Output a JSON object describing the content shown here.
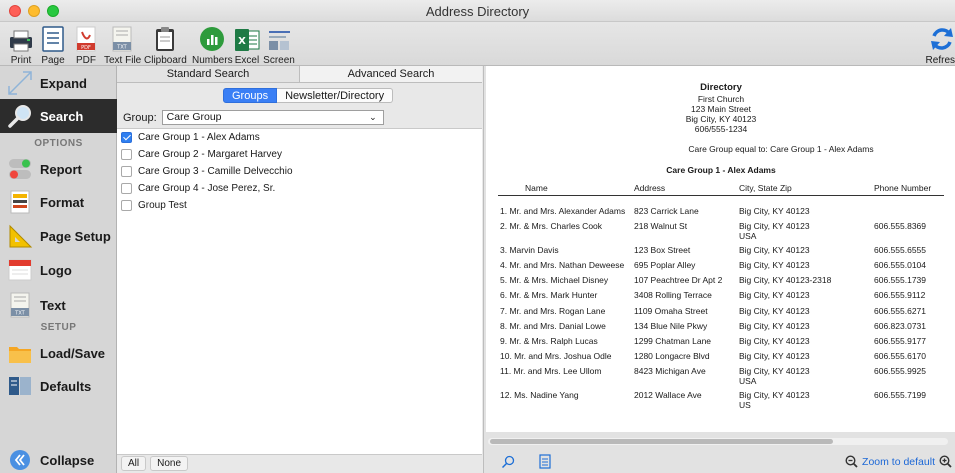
{
  "window": {
    "title": "Address Directory"
  },
  "toolbar": {
    "items": [
      {
        "label": "Print",
        "icon": "printer-icon"
      },
      {
        "label": "Page",
        "icon": "page-icon"
      },
      {
        "label": "PDF",
        "icon": "pdf-icon"
      },
      {
        "label": "Text File",
        "icon": "text-file-icon"
      },
      {
        "label": "Clipboard",
        "icon": "clipboard-icon"
      },
      {
        "label": "Numbers",
        "icon": "numbers-icon"
      },
      {
        "label": "Excel",
        "icon": "excel-icon"
      },
      {
        "label": "Screen",
        "icon": "screen-icon"
      }
    ],
    "refresh_label": "Refres"
  },
  "sidebar": {
    "items": [
      {
        "label": "Expand",
        "icon": "expand-icon"
      },
      {
        "label": "Search",
        "icon": "search-icon",
        "active": true
      },
      {
        "label": "Report",
        "icon": "toggle-icon"
      },
      {
        "label": "Format",
        "icon": "format-icon"
      },
      {
        "label": "Page Setup",
        "icon": "page-setup-icon"
      },
      {
        "label": "Logo",
        "icon": "logo-icon"
      },
      {
        "label": "Text",
        "icon": "text-icon"
      },
      {
        "label": "Load/Save",
        "icon": "folder-icon"
      },
      {
        "label": "Defaults",
        "icon": "defaults-icon"
      },
      {
        "label": "Collapse",
        "icon": "collapse-icon"
      }
    ],
    "section_options": "OPTIONS",
    "section_setup": "SETUP"
  },
  "search": {
    "tabs": [
      "Standard Search",
      "Advanced Search"
    ],
    "subtabs": [
      "Groups",
      "Newsletter/Directory"
    ],
    "group_label": "Group:",
    "group_value": "Care Group",
    "groups": [
      {
        "name": "Care Group 1 - Alex Adams",
        "checked": true
      },
      {
        "name": "Care Group 2 - Margaret Harvey",
        "checked": false
      },
      {
        "name": "Care Group 3 - Camille Delvecchio",
        "checked": false
      },
      {
        "name": "Care Group 4 - Jose Perez, Sr.",
        "checked": false
      },
      {
        "name": "Group Test",
        "checked": false
      }
    ],
    "all_label": "All",
    "none_label": "None"
  },
  "preview": {
    "title": "Directory",
    "org": "First Church",
    "street": "123 Main Street",
    "city": "Big City, KY  40123",
    "phone": "606/555-1234",
    "criteria": "Care Group equal to: Care Group 1 - Alex Adams",
    "group_heading": "Care Group 1 - Alex Adams",
    "columns": [
      "Name",
      "Address",
      "City, State  Zip",
      "Phone Number"
    ],
    "rows": [
      {
        "name": "1. Mr. and Mrs. Alexander Adams",
        "address": "823 Carrick Lane",
        "city": "Big City, KY 40123",
        "city2": "",
        "phone": ""
      },
      {
        "name": "2. Mr. & Mrs. Charles Cook",
        "address": "218 Walnut St",
        "city": "Big City, KY 40123",
        "city2": "USA",
        "phone": "606.555.8369"
      },
      {
        "name": "3. Marvin Davis",
        "address": "123 Box Street",
        "city": "Big City, KY 40123",
        "city2": "",
        "phone": "606.555.6555"
      },
      {
        "name": "4. Mr. and Mrs. Nathan Deweese",
        "address": "695 Poplar Alley",
        "city": "Big City, KY 40123",
        "city2": "",
        "phone": "606.555.0104"
      },
      {
        "name": "5. Mr. & Mrs. Michael Disney",
        "address": "107 Peachtree Dr  Apt 2",
        "city": "Big City, KY 40123-2318",
        "city2": "",
        "phone": "606.555.1739"
      },
      {
        "name": "6. Mr. & Mrs. Mark Hunter",
        "address": "3408 Rolling Terrace",
        "city": "Big City, KY 40123",
        "city2": "",
        "phone": "606.555.9112"
      },
      {
        "name": "7. Mr. and Mrs. Rogan Lane",
        "address": "1109 Omaha Street",
        "city": "Big City, KY 40123",
        "city2": "",
        "phone": "606.555.6271"
      },
      {
        "name": "8. Mr. and Mrs. Danial Lowe",
        "address": "134 Blue Nile Pkwy",
        "city": "Big City, KY 40123",
        "city2": "",
        "phone": "606.823.0731"
      },
      {
        "name": "9. Mr. & Mrs. Ralph Lucas",
        "address": "1299 Chatman Lane",
        "city": "Big City, KY 40123",
        "city2": "",
        "phone": "606.555.9177"
      },
      {
        "name": "10. Mr. and Mrs. Joshua Odle",
        "address": "1280 Longacre Blvd",
        "city": "Big City, KY 40123",
        "city2": "",
        "phone": "606.555.6170"
      },
      {
        "name": "11. Mr. and Mrs. Lee Ullom",
        "address": "8423 Michigan Ave",
        "city": "Big City, KY 40123",
        "city2": "USA",
        "phone": "606.555.9925"
      },
      {
        "name": "12. Ms. Nadine Yang",
        "address": "2012 Wallace Ave",
        "city": "Big City, KY 40123",
        "city2": "US",
        "phone": "606.555.7199"
      }
    ],
    "zoom_label": "Zoom to default"
  }
}
